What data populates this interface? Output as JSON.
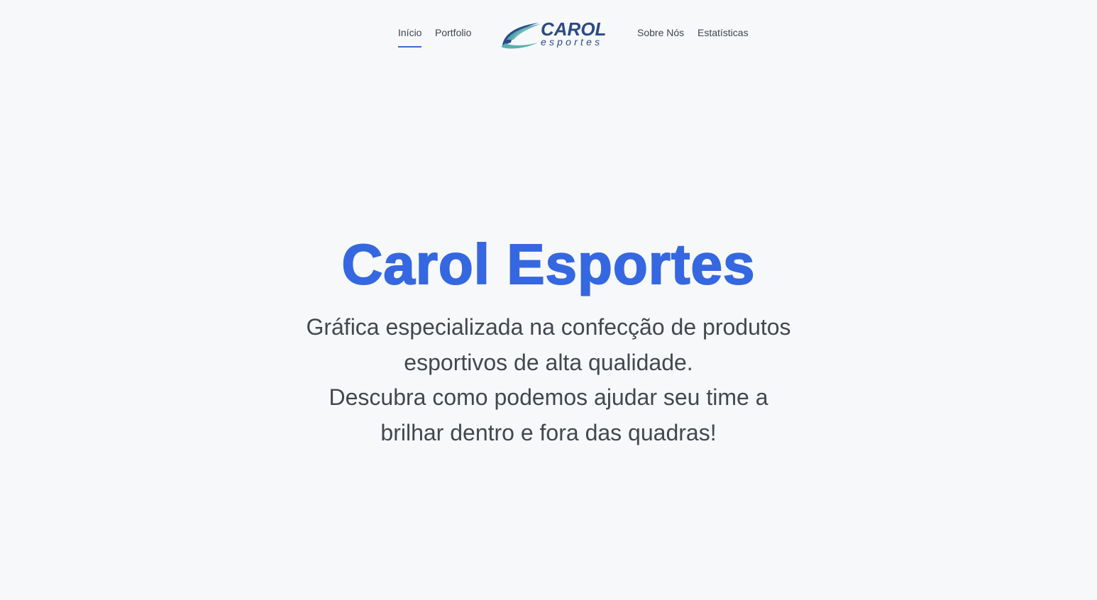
{
  "nav": {
    "items_left": [
      {
        "label": "Início",
        "active": true
      },
      {
        "label": "Portfolio",
        "active": false
      }
    ],
    "items_right": [
      {
        "label": "Sobre Nós",
        "active": false
      },
      {
        "label": "Estatísticas",
        "active": false
      }
    ],
    "logo": {
      "icon": "swoosh-logo-icon",
      "brand": "CAROL",
      "tagline": "esportes"
    }
  },
  "hero": {
    "title": "Carol Esportes",
    "lines": [
      "Gráfica especializada na confecção de produtos",
      "esportivos de alta qualidade.",
      "Descubra como podemos ajudar seu time a",
      "brilhar dentro e fora das quadras!"
    ]
  },
  "colors": {
    "accent": "#3568e0",
    "logo_dark": "#2a4a86",
    "logo_teal": "#5aafb0",
    "background": "#f7f8fa",
    "text": "#43474f"
  }
}
